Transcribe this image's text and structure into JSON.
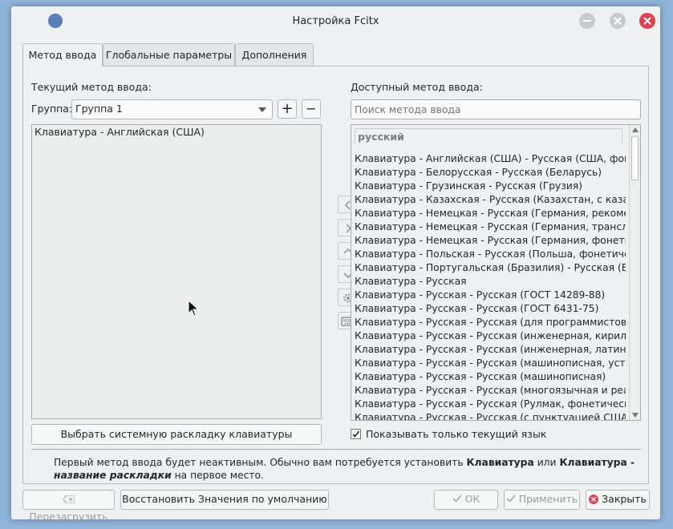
{
  "window": {
    "title": "Настройка Fcitx",
    "tabs": [
      {
        "label": "Метод ввода"
      },
      {
        "label": "Глобальные параметры"
      },
      {
        "label": "Дополнения"
      }
    ]
  },
  "left": {
    "current_label": "Текущий метод ввода:",
    "group_label": "Группа:",
    "group_value": "Группа 1",
    "add_symbol": "+",
    "remove_symbol": "−",
    "items": [
      "Клавиатура - Английская (США)"
    ],
    "select_layout_button": "Выбрать системную раскладку клавиатуры"
  },
  "right": {
    "available_label": "Доступный метод ввода:",
    "search_placeholder": "Поиск метода ввода",
    "language_header": "русский",
    "items": [
      "Клавиатура - Английская (США) - Русская (США, фонетическая)",
      "Клавиатура - Белорусская - Русская (Беларусь)",
      "Клавиатура - Грузинская - Русская (Грузия)",
      "Клавиатура - Казахская - Русская (Казахстан, с казахской)",
      "Клавиатура - Немецкая - Русская (Германия, рекомендуемая)",
      "Клавиатура - Немецкая - Русская (Германия, транслитерация)",
      "Клавиатура - Немецкая - Русская (Германия, фонетическая)",
      "Клавиатура - Польская - Русская (Польша, фонетическая)",
      "Клавиатура - Португальская (Бразилия) - Русская (Бразилия)",
      "Клавиатура - Русская",
      "Клавиатура - Русская - Русская (ГОСТ 14289-88)",
      "Клавиатура - Русская - Русская (ГОСТ 6431-75)",
      "Клавиатура - Русская - Русская (для программистов)",
      "Клавиатура - Русская - Русская (инженерная, кириллица)",
      "Клавиатура - Русская - Русская (инженерная, латиница)",
      "Клавиатура - Русская - Русская (машинописная, устаревшая)",
      "Клавиатура - Русская - Русская (машинописная)",
      "Клавиатура - Русская - Русская (многоязычная и реакционная)",
      "Клавиатура - Русская - Русская (Рулмак, фонетическая, К...)",
      "Клавиатура - Русская - Русская (с пунктуацией США)"
    ],
    "only_current_language_label": "Показывать только текущий язык",
    "only_current_language_checked": true
  },
  "info": {
    "text_before": "Первый метод ввода будет неактивным. Обычно вам потребуется установить ",
    "bold1": "Клавиатура",
    "text_mid": " или ",
    "bold2": "Клавиатура - ",
    "bold_italic": "название раскладки",
    "text_after": " на первое место."
  },
  "footer": {
    "reload": "Перезагрузить",
    "restore_defaults": "Восстановить Значения по умолчанию",
    "ok": "ОК",
    "apply": "Применить",
    "close": "Закрыть"
  },
  "colors": {
    "window_bg": "#eff0f1",
    "close_red": "#da4453",
    "desktop": "#8fb3d9"
  }
}
